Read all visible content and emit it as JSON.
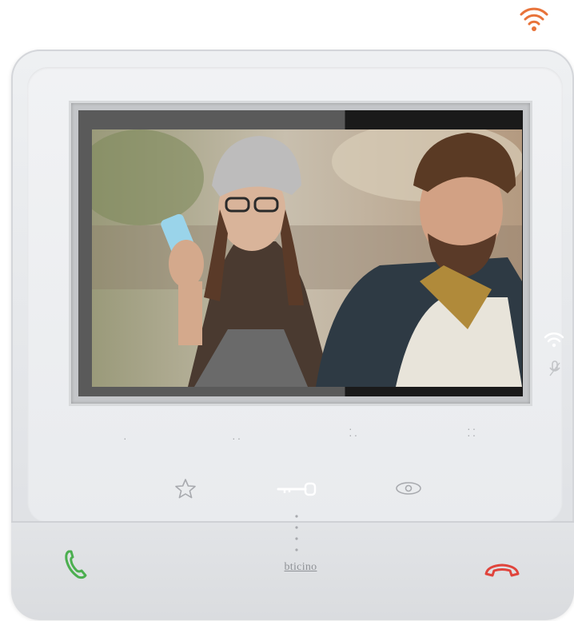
{
  "device": {
    "brand_label": "bticino",
    "colors": {
      "answer": "#4caf50",
      "hangup": "#e0443c",
      "wifi_top": "#e8733a"
    }
  },
  "icons": {
    "wifi_top": "wifi-icon",
    "side_wifi": "wifi-icon",
    "side_mic": "microphone-icon",
    "favorite": "star-icon",
    "door_lock": "key-icon",
    "view": "eye-icon",
    "answer": "phone-icon",
    "hangup": "hangup-icon"
  }
}
